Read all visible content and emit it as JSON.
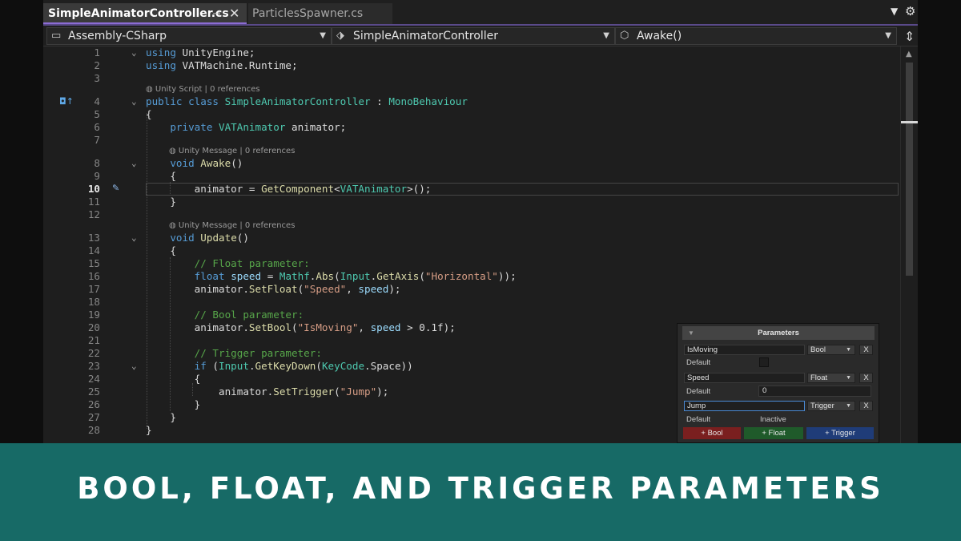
{
  "tabs": [
    {
      "label": "SimpleAnimatorController.cs",
      "pin_icon": "pin-icon",
      "close_icon": "close-icon"
    },
    {
      "label": "ParticlesSpawner.cs"
    }
  ],
  "tabstrip": {
    "overflow_icon": "chevron-down-icon",
    "settings_icon": "gear-icon"
  },
  "navbar": {
    "project": "Assembly-CSharp",
    "class": "SimpleAnimatorController",
    "member": "Awake()",
    "split_icon": "split-icon"
  },
  "codelens": {
    "unity_script": "Unity Script | 0 references",
    "awake_msg": "Unity Message | 0 references",
    "update_msg": "Unity Message | 0 references"
  },
  "code_lines": [
    {
      "n": "1",
      "tokens": [
        {
          "t": "using",
          "c": "k"
        },
        {
          "t": " UnityEngine;",
          "c": "p"
        }
      ]
    },
    {
      "n": "2",
      "tokens": [
        {
          "t": "using",
          "c": "k"
        },
        {
          "t": " VATMachine.Runtime;",
          "c": "p"
        }
      ]
    },
    {
      "n": "3",
      "tokens": []
    },
    {
      "n": "4",
      "tokens": [
        {
          "t": "public",
          "c": "k"
        },
        {
          "t": " ",
          "c": "p"
        },
        {
          "t": "class",
          "c": "k"
        },
        {
          "t": " ",
          "c": "p"
        },
        {
          "t": "SimpleAnimatorController",
          "c": "t"
        },
        {
          "t": " : ",
          "c": "p"
        },
        {
          "t": "MonoBehaviour",
          "c": "t"
        }
      ]
    },
    {
      "n": "5",
      "tokens": [
        {
          "t": "{",
          "c": "p"
        }
      ]
    },
    {
      "n": "6",
      "tokens": [
        {
          "t": "    ",
          "c": "p"
        },
        {
          "t": "private",
          "c": "k"
        },
        {
          "t": " ",
          "c": "p"
        },
        {
          "t": "VATAnimator",
          "c": "t"
        },
        {
          "t": " animator;",
          "c": "p"
        }
      ]
    },
    {
      "n": "7",
      "tokens": []
    },
    {
      "n": "8",
      "tokens": [
        {
          "t": "    ",
          "c": "p"
        },
        {
          "t": "void",
          "c": "k"
        },
        {
          "t": " ",
          "c": "p"
        },
        {
          "t": "Awake",
          "c": "m"
        },
        {
          "t": "()",
          "c": "p"
        }
      ]
    },
    {
      "n": "9",
      "tokens": [
        {
          "t": "    {",
          "c": "p"
        }
      ]
    },
    {
      "n": "10",
      "tokens": [
        {
          "t": "        animator = ",
          "c": "p"
        },
        {
          "t": "GetComponent",
          "c": "m"
        },
        {
          "t": "<",
          "c": "p"
        },
        {
          "t": "VATAnimator",
          "c": "t"
        },
        {
          "t": ">();",
          "c": "p"
        }
      ]
    },
    {
      "n": "11",
      "tokens": [
        {
          "t": "    }",
          "c": "p"
        }
      ]
    },
    {
      "n": "12",
      "tokens": []
    },
    {
      "n": "13",
      "tokens": [
        {
          "t": "    ",
          "c": "p"
        },
        {
          "t": "void",
          "c": "k"
        },
        {
          "t": " ",
          "c": "p"
        },
        {
          "t": "Update",
          "c": "m"
        },
        {
          "t": "()",
          "c": "p"
        }
      ]
    },
    {
      "n": "14",
      "tokens": [
        {
          "t": "    {",
          "c": "p"
        }
      ]
    },
    {
      "n": "15",
      "tokens": [
        {
          "t": "        ",
          "c": "p"
        },
        {
          "t": "// Float parameter:",
          "c": "c"
        }
      ]
    },
    {
      "n": "16",
      "tokens": [
        {
          "t": "        ",
          "c": "p"
        },
        {
          "t": "float",
          "c": "k"
        },
        {
          "t": " ",
          "c": "p"
        },
        {
          "t": "speed",
          "c": "v"
        },
        {
          "t": " = ",
          "c": "p"
        },
        {
          "t": "Mathf",
          "c": "t"
        },
        {
          "t": ".",
          "c": "p"
        },
        {
          "t": "Abs",
          "c": "m"
        },
        {
          "t": "(",
          "c": "p"
        },
        {
          "t": "Input",
          "c": "t"
        },
        {
          "t": ".",
          "c": "p"
        },
        {
          "t": "GetAxis",
          "c": "m"
        },
        {
          "t": "(",
          "c": "p"
        },
        {
          "t": "\"Horizontal\"",
          "c": "s"
        },
        {
          "t": "));",
          "c": "p"
        }
      ]
    },
    {
      "n": "17",
      "tokens": [
        {
          "t": "        animator.",
          "c": "p"
        },
        {
          "t": "SetFloat",
          "c": "m"
        },
        {
          "t": "(",
          "c": "p"
        },
        {
          "t": "\"Speed\"",
          "c": "s"
        },
        {
          "t": ", ",
          "c": "p"
        },
        {
          "t": "speed",
          "c": "v"
        },
        {
          "t": ");",
          "c": "p"
        }
      ]
    },
    {
      "n": "18",
      "tokens": []
    },
    {
      "n": "19",
      "tokens": [
        {
          "t": "        ",
          "c": "p"
        },
        {
          "t": "// Bool parameter:",
          "c": "c"
        }
      ]
    },
    {
      "n": "20",
      "tokens": [
        {
          "t": "        animator.",
          "c": "p"
        },
        {
          "t": "SetBool",
          "c": "m"
        },
        {
          "t": "(",
          "c": "p"
        },
        {
          "t": "\"IsMoving\"",
          "c": "s"
        },
        {
          "t": ", ",
          "c": "p"
        },
        {
          "t": "speed",
          "c": "v"
        },
        {
          "t": " > 0.1f);",
          "c": "p"
        }
      ]
    },
    {
      "n": "21",
      "tokens": []
    },
    {
      "n": "22",
      "tokens": [
        {
          "t": "        ",
          "c": "p"
        },
        {
          "t": "// Trigger parameter:",
          "c": "c"
        }
      ]
    },
    {
      "n": "23",
      "tokens": [
        {
          "t": "        ",
          "c": "p"
        },
        {
          "t": "if",
          "c": "k"
        },
        {
          "t": " (",
          "c": "p"
        },
        {
          "t": "Input",
          "c": "t"
        },
        {
          "t": ".",
          "c": "p"
        },
        {
          "t": "GetKeyDown",
          "c": "m"
        },
        {
          "t": "(",
          "c": "p"
        },
        {
          "t": "KeyCode",
          "c": "t"
        },
        {
          "t": ".Space))",
          "c": "p"
        }
      ]
    },
    {
      "n": "24",
      "tokens": [
        {
          "t": "        {",
          "c": "p"
        }
      ]
    },
    {
      "n": "25",
      "tokens": [
        {
          "t": "            animator.",
          "c": "p"
        },
        {
          "t": "SetTrigger",
          "c": "m"
        },
        {
          "t": "(",
          "c": "p"
        },
        {
          "t": "\"Jump\"",
          "c": "s"
        },
        {
          "t": ");",
          "c": "p"
        }
      ]
    },
    {
      "n": "26",
      "tokens": [
        {
          "t": "        }",
          "c": "p"
        }
      ]
    },
    {
      "n": "27",
      "tokens": [
        {
          "t": "    }",
          "c": "p"
        }
      ]
    },
    {
      "n": "28",
      "tokens": [
        {
          "t": "}",
          "c": "p"
        }
      ]
    }
  ],
  "current_line": "10",
  "parameters_panel": {
    "title": "Parameters",
    "params": [
      {
        "name": "IsMoving",
        "type": "Bool",
        "remove": "X",
        "default_label": "Default",
        "default_value": ""
      },
      {
        "name": "Speed",
        "type": "Float",
        "remove": "X",
        "default_label": "Default",
        "default_value": "0"
      },
      {
        "name": "Jump",
        "type": "Trigger",
        "remove": "X",
        "default_label": "Default",
        "default_value": "Inactive"
      }
    ],
    "add_buttons": [
      "+ Bool",
      "+ Float",
      "+ Trigger"
    ]
  },
  "banner_caption": "Bool, Float, and Trigger Parameters",
  "colors": {
    "keyword": "#569cd6",
    "type": "#4ec9b0",
    "method": "#dcdcaa",
    "string": "#d69d85",
    "comment": "#57a64a",
    "variable": "#9cdcfe",
    "banner": "#176a66",
    "add_bool": "#7a1f1f",
    "add_float": "#1f5a2a",
    "add_trigger": "#1f3c78"
  }
}
